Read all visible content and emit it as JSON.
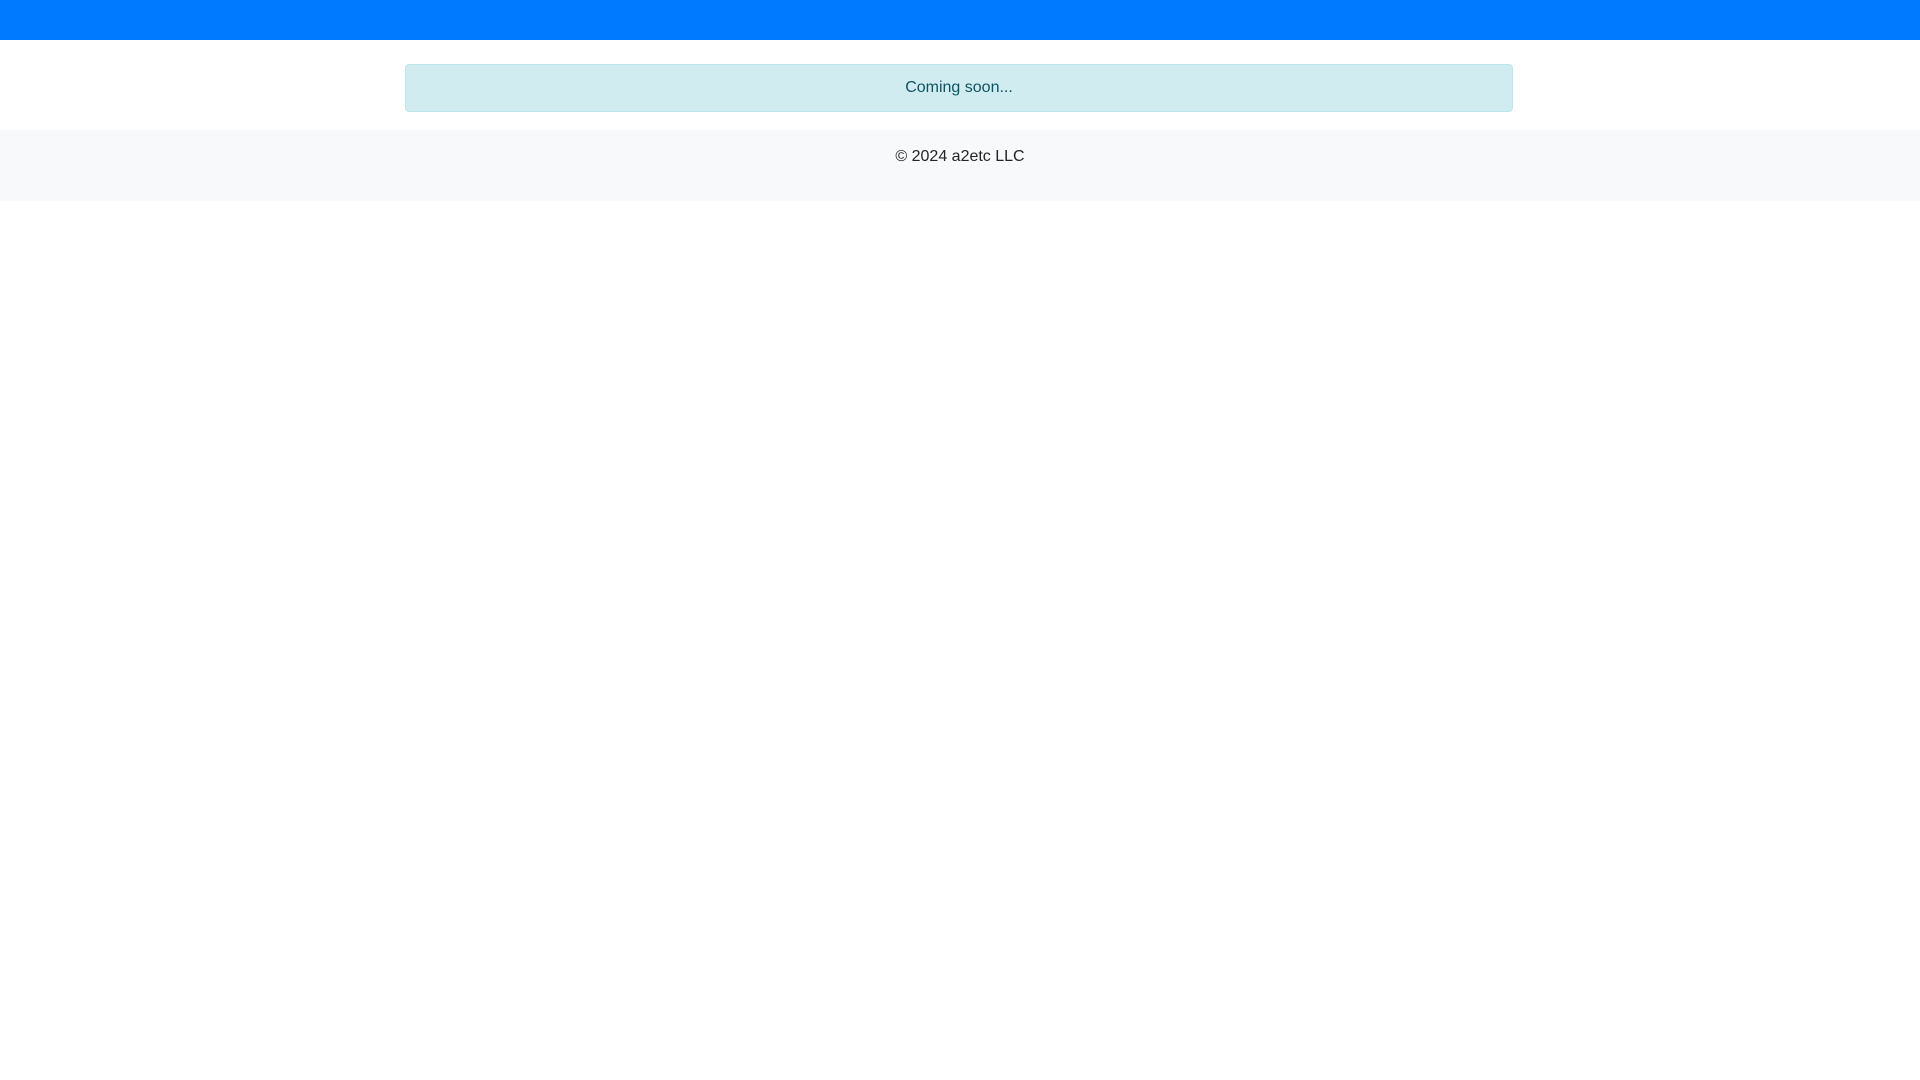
{
  "colors": {
    "navbar_bg": "#007bff",
    "alert_bg": "#d1ecf1",
    "alert_border": "#bee5eb",
    "alert_text": "#0c5460",
    "footer_bg": "#f8f9fa",
    "page_bg": "#ffffff"
  },
  "main": {
    "alert_text": "Coming soon..."
  },
  "footer": {
    "copyright": "© 2024 a2etc LLC"
  }
}
